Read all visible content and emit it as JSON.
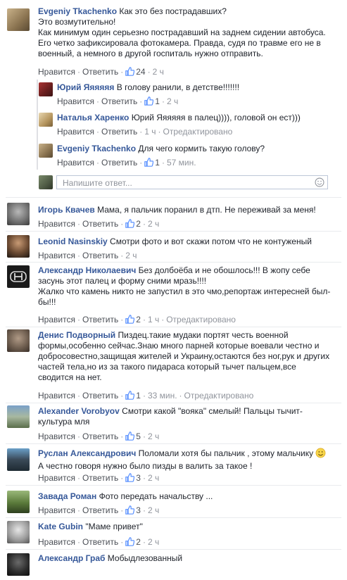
{
  "actions": {
    "like": "Нравится",
    "reply": "Ответить",
    "edited": "Отредактировано"
  },
  "colors": {
    "link": "#365899",
    "meta": "#90949c",
    "like_blue": "#5890ff"
  },
  "reply_input": {
    "placeholder": "Напишите ответ..."
  },
  "comments": [
    {
      "author": "Evgeniy Tkachenko",
      "first": "Как это без пострадавших?",
      "rest": [
        "Это возмутительно!",
        "Как минимум один серьезно пострадавший на заднем сидении автобуса.",
        "Его четко зафиксировала фотокамера. Правда, судя по травме его не в",
        "военный, а немного в другой госпиталь нужно отправить."
      ],
      "likes": "24",
      "time": "2 ч",
      "edited": false
    },
    {
      "author": "Юрий Яяяяяя",
      "first": "В голову ранили, в детстве!!!!!!!",
      "rest": [],
      "likes": "1",
      "time": "2 ч",
      "edited": false
    },
    {
      "author": "Наталья Харенко",
      "first": "Юрий Яяяяяя в палец)))), головой он ест)))",
      "rest": [],
      "likes": "",
      "time": "1 ч",
      "edited": true
    },
    {
      "author": "Evgeniy Tkachenko",
      "first": "Для чего кормить такую голову?",
      "rest": [],
      "likes": "1",
      "time": "57 мин.",
      "edited": false
    },
    {
      "author": "Игорь Квачев",
      "first": "Мама, я пальчик поранил в дтп. Не переживай за меня!",
      "rest": [],
      "likes": "2",
      "time": "2 ч",
      "edited": false
    },
    {
      "author": "Leonid Nasinskiy",
      "first": "Смотри фото и вот скажи потом что не контуженый",
      "rest": [],
      "likes": "",
      "time": "2 ч",
      "edited": false
    },
    {
      "author": "Александр Николаевич",
      "first": "Без долбоёба и не обошлось!!! В жопу себе",
      "rest": [
        "засунь этот палец и форму сними мразь!!!!",
        "Жалко что камень никто не запустил в это чмо,репортаж интересней был-",
        "бы!!!"
      ],
      "likes": "2",
      "time": "1 ч",
      "edited": true
    },
    {
      "author": "Денис Подворный",
      "first": "Пиздец.такие мудаки портят честь военной",
      "rest": [
        "формы,особенно сейчас.Знаю много парней которые воевали честно и",
        "добросовестно,защищая жителей и Украину,остаются без ног,рук и других",
        "частей тела,но из за такого пидараса который тычет пальцем,все",
        "сводится на нет."
      ],
      "likes": "1",
      "time": "33 мин.",
      "edited": true
    },
    {
      "author": "Alexander Vorobyov",
      "first": "Смотри какой \"вояка\" смелый! Пальцы тычит-",
      "rest": [
        "культура мля"
      ],
      "likes": "5",
      "time": "2 ч",
      "edited": false
    },
    {
      "author": "Руслан Александрович",
      "first": "Поломали хотя бы пальчик , этому мальчику",
      "rest": [
        "А честно говоря нужно было пизды в валить за такое !"
      ],
      "likes": "3",
      "time": "2 ч",
      "edited": false
    },
    {
      "author": "Завада Роман",
      "first": "Фото передать начальству ...",
      "rest": [],
      "likes": "3",
      "time": "2 ч",
      "edited": false
    },
    {
      "author": "Kate Gubin",
      "first": "\"Маме привет\"",
      "rest": [],
      "likes": "2",
      "time": "2 ч",
      "edited": false
    },
    {
      "author": "Александр Граб",
      "first": "Мобыдлезованный",
      "rest": [],
      "likes": "",
      "time": "",
      "edited": false
    }
  ]
}
